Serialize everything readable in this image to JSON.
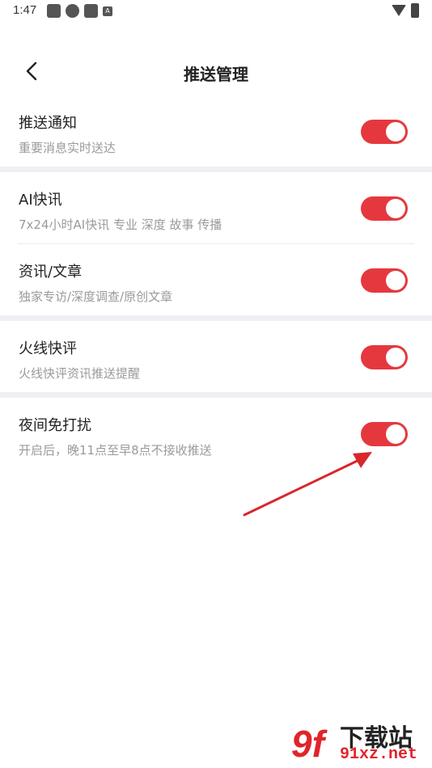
{
  "status_bar": {
    "time": "1:47",
    "icons": [
      "app-icon",
      "sync-icon",
      "app-icon",
      "a-icon"
    ],
    "a_glyph": "A"
  },
  "header": {
    "title": "推送管理",
    "back_icon": "chevron-left-icon"
  },
  "settings": [
    {
      "title": "推送通知",
      "subtitle": "重要消息实时送达",
      "enabled": true
    },
    {
      "title": "AI快讯",
      "subtitle": "7x24小时AI快讯 专业 深度 故事 传播",
      "enabled": true
    },
    {
      "title": "资讯/文章",
      "subtitle": "独家专访/深度调查/原创文章",
      "enabled": true
    },
    {
      "title": "火线快评",
      "subtitle": "火线快评资讯推送提醒",
      "enabled": true
    },
    {
      "title": "夜间免打扰",
      "subtitle": "开启后，晚11点至早8点不接收推送",
      "enabled": true
    }
  ],
  "colors": {
    "accent": "#e5383e",
    "separator": "#eef0f3",
    "subtitle": "#9a9a9a"
  },
  "watermark": {
    "logo": "9f",
    "text": "下载站",
    "url": "91xz.net"
  }
}
